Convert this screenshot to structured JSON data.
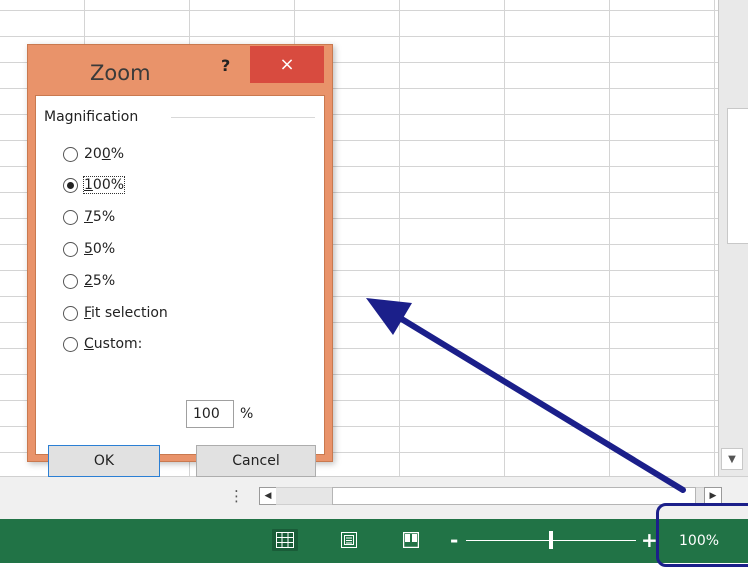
{
  "dialog": {
    "title": "Zoom",
    "help_symbol": "?",
    "close_symbol": "×",
    "group_label": "Magnification",
    "options": [
      {
        "prefix": "20",
        "mnemonic": "0",
        "suffix": "%"
      },
      {
        "prefix": "",
        "mnemonic": "1",
        "suffix": "00%"
      },
      {
        "prefix": "",
        "mnemonic": "7",
        "suffix": "5%"
      },
      {
        "prefix": "",
        "mnemonic": "5",
        "suffix": "0%"
      },
      {
        "prefix": "",
        "mnemonic": "2",
        "suffix": "5%"
      },
      {
        "prefix": "",
        "mnemonic": "F",
        "suffix": "it selection"
      },
      {
        "prefix": "",
        "mnemonic": "C",
        "suffix": "ustom:"
      }
    ],
    "selected_option": "100%",
    "custom_value": "100",
    "percent_sign": "%",
    "ok_label": "OK",
    "cancel_label": "Cancel"
  },
  "status_bar": {
    "zoom_minus": "-",
    "zoom_plus": "+",
    "zoom_level": "100%",
    "icons": [
      "normal-view-icon",
      "page-layout-view-icon",
      "page-break-preview-icon"
    ]
  },
  "sheet_bar": {
    "tab_split_symbol": "⋮",
    "scroll_left_symbol": "◀",
    "scroll_right_symbol": "▶",
    "scroll_down_symbol": "▼"
  },
  "colors": {
    "dialog_frame": "#e9936a",
    "close_button": "#d84b3f",
    "status_bar": "#217346",
    "annotation": "#1b1f8a"
  }
}
